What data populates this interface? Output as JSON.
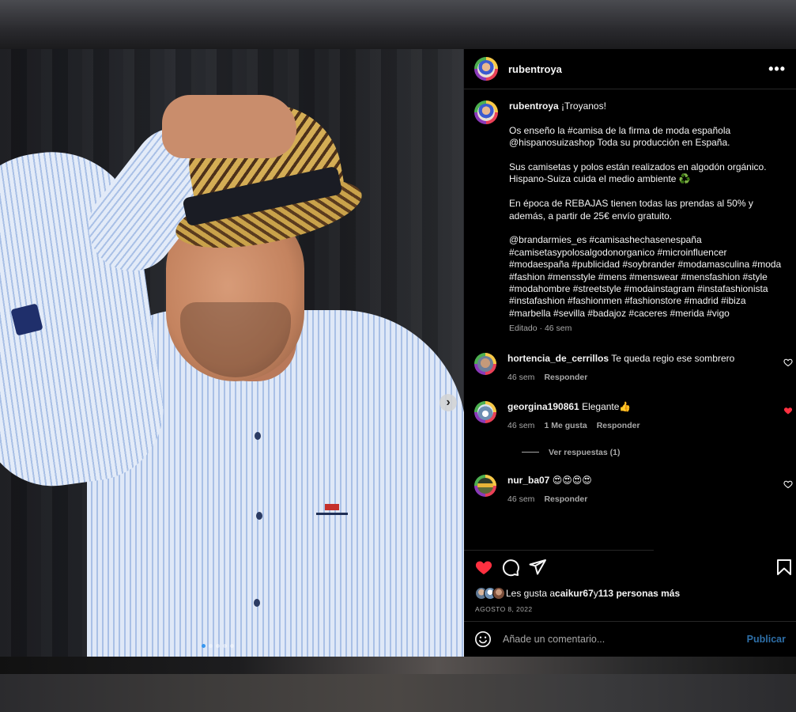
{
  "post": {
    "username": "rubentroya",
    "more_icon": "more-horizontal-icon",
    "caption": {
      "username": "rubentroya",
      "lines": [
        "¡Troyanos!",
        "Os enseño la #camisa de la firma de moda española @hispanosuizashop Toda su producción en España.",
        "Sus camisetas y polos están realizados en algodón orgánico. Hispano-Suiza cuida el medio ambiente ♻️",
        "En época de REBAJAS tienen todas las prendas al 50% y además, a partir de 25€ envío gratuito.",
        "@brandarmies_es #camisashechasenespaña #camisetasypolosalgodonorganico #microinfluencer #modaespaña #publicidad #soybrander #modamasculina #moda #fashion #mensstyle #mens #menswear #mensfashion #style #modahombre #streetstyle #modainstagram #instafashionista #instafashion #fashionmen #fashionstore #madrid #ibiza #marbella #sevilla #badajoz #caceres #merida #vigo"
      ],
      "meta": "Editado · 46 sem"
    },
    "comments": [
      {
        "username": "hortencia_de_cerrillos",
        "text": "Te queda regio ese sombrero",
        "time": "46 sem",
        "likes": "",
        "reply": "Responder",
        "liked": false
      },
      {
        "username": "georgina190861",
        "text": "Elegante👍",
        "time": "46 sem",
        "likes": "1 Me gusta",
        "reply": "Responder",
        "liked": true,
        "view_replies": "Ver respuestas (1)"
      },
      {
        "username": "nur_ba07",
        "text": "😍😍😍😍",
        "time": "46 sem",
        "likes": "",
        "reply": "Responder",
        "liked": false
      }
    ],
    "actions": {
      "like_icon": "heart-filled-icon",
      "comment_icon": "comment-icon",
      "share_icon": "send-icon",
      "save_icon": "bookmark-icon",
      "liked": true
    },
    "likes": {
      "prefix": "Les gusta a ",
      "user": "caikur67",
      "middle": " y ",
      "others": "113 personas más"
    },
    "date": "AGOSTO 8, 2022",
    "add_comment": {
      "placeholder": "Añade un comentario...",
      "publish": "Publicar",
      "emoji_icon": "emoji-icon"
    },
    "carousel": {
      "next_icon": "chevron-right-icon",
      "slides": 5,
      "current": 1
    },
    "colors": {
      "accent_blue": "#3897f0",
      "like_red": "#ff3040",
      "publish_blue": "#2e6fa8"
    }
  }
}
